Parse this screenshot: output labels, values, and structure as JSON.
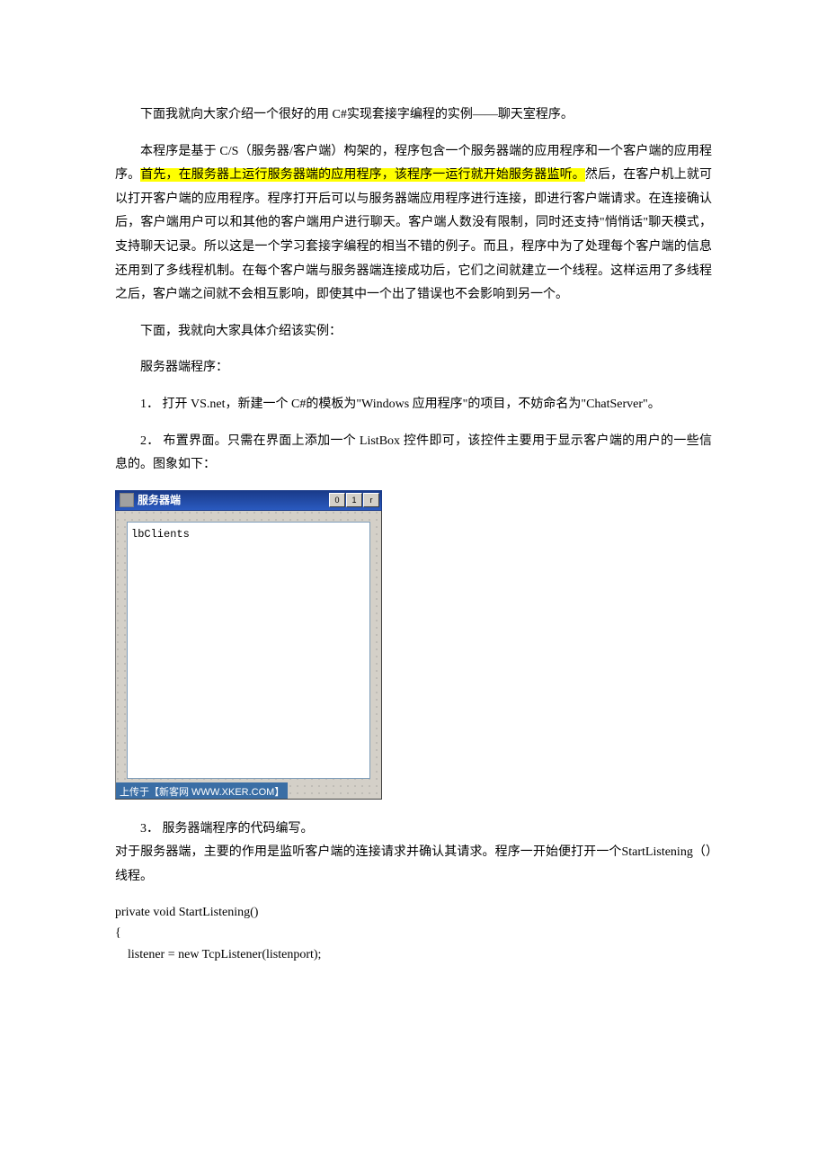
{
  "doc": {
    "p1": "下面我就向大家介绍一个很好的用 C#实现套接字编程的实例——聊天室程序。",
    "p2a": "本程序是基于 C/S（服务器/客户端）构架的，程序包含一个服务器端的应用程序和一个客户端的应用程序。",
    "p2_highlight": "首先，在服务器上运行服务器端的应用程序，该程序一运行就开始服务器监听。",
    "p2b": "然后，在客户机上就可以打开客户端的应用程序。程序打开后可以与服务器端应用程序进行连接，即进行客户端请求。在连接确认后，客户端用户可以和其他的客户端用户进行聊天。客户端人数没有限制，同时还支持\"悄悄话\"聊天模式，支持聊天记录。所以这是一个学习套接字编程的相当不错的例子。而且，程序中为了处理每个客户端的信息还用到了多线程机制。在每个客户端与服务器端连接成功后，它们之间就建立一个线程。这样运用了多线程之后，客户端之间就不会相互影响，即使其中一个出了错误也不会影响到另一个。",
    "p3": "下面，我就向大家具体介绍该实例：",
    "p4": "服务器端程序：",
    "p5": "1．  打开 VS.net，新建一个 C#的模板为\"Windows 应用程序\"的项目，不妨命名为\"ChatServer\"。",
    "p6": "2．  布置界面。只需在界面上添加一个 ListBox 控件即可，该控件主要用于显示客户端的用户的一些信息的。图象如下：",
    "p7": "3．  服务器端程序的代码编写。",
    "p8": "对于服务器端，主要的作用是监听客户端的连接请求并确认其请求。程序一开始便打开一个StartListening（）线程。",
    "code_l1": "private void StartListening()",
    "code_l2": "{",
    "code_l3": "    listener = new TcpListener(listenport);"
  },
  "designer": {
    "title": "服务器端",
    "listbox_text": "lbClients",
    "watermark": "上传于【新客网 WWW.XKER.COM】",
    "btn_min": "0",
    "btn_max": "1",
    "btn_close": "r"
  }
}
